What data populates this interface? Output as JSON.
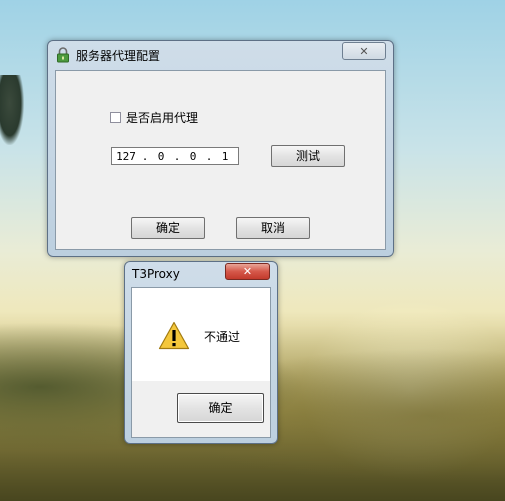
{
  "proxy_dialog": {
    "title": "服务器代理配置",
    "close_label": "✕",
    "enable_proxy_label": "是否启用代理",
    "enable_proxy_checked": false,
    "ip_segments": [
      "127",
      "0",
      "0",
      "1"
    ],
    "ip_separator": ".",
    "test_button": "测试",
    "ok_button": "确定",
    "cancel_button": "取消"
  },
  "message_box": {
    "title": "T3Proxy",
    "close_label": "✕",
    "message": "不通过",
    "icon": "warning-icon",
    "ok_button": "确定"
  },
  "colors": {
    "close_red": "#c9463d",
    "title_bar": "#c6d8e8"
  }
}
